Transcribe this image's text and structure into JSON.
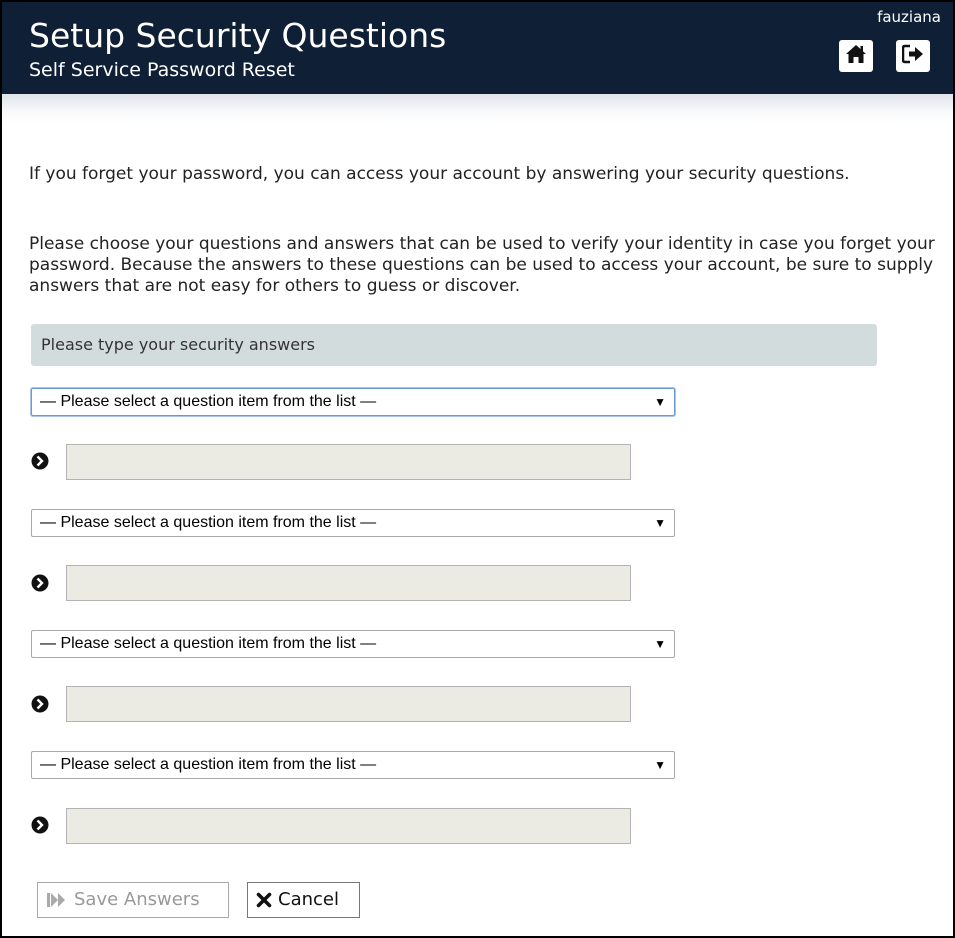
{
  "header": {
    "title": "Setup Security Questions",
    "subtitle": "Self Service Password Reset",
    "username": "fauziana",
    "home_icon": "home-icon",
    "logout_icon": "sign-out-icon",
    "background_color": "#0f1f36"
  },
  "intro": {
    "paragraph1": "If you forget your password, you can access your account by answering your security questions.",
    "paragraph2": "Please choose your questions and answers that can be used to verify your identity in case you forget your password. Because the answers to these questions can be used to access your account, be sure to supply answers that are not easy for others to guess or discover."
  },
  "section": {
    "heading": "Please type your security answers"
  },
  "questions": [
    {
      "select_value": "— Please select a question item from the list —",
      "answer_value": ""
    },
    {
      "select_value": "— Please select a question item from the list —",
      "answer_value": ""
    },
    {
      "select_value": "— Please select a question item from the list —",
      "answer_value": ""
    },
    {
      "select_value": "— Please select a question item from the list —",
      "answer_value": ""
    }
  ],
  "select_arrow": "▼",
  "buttons": {
    "save_label": "Save Answers",
    "save_icon": "fast-forward-icon",
    "cancel_label": "Cancel",
    "cancel_icon": "close-icon"
  }
}
